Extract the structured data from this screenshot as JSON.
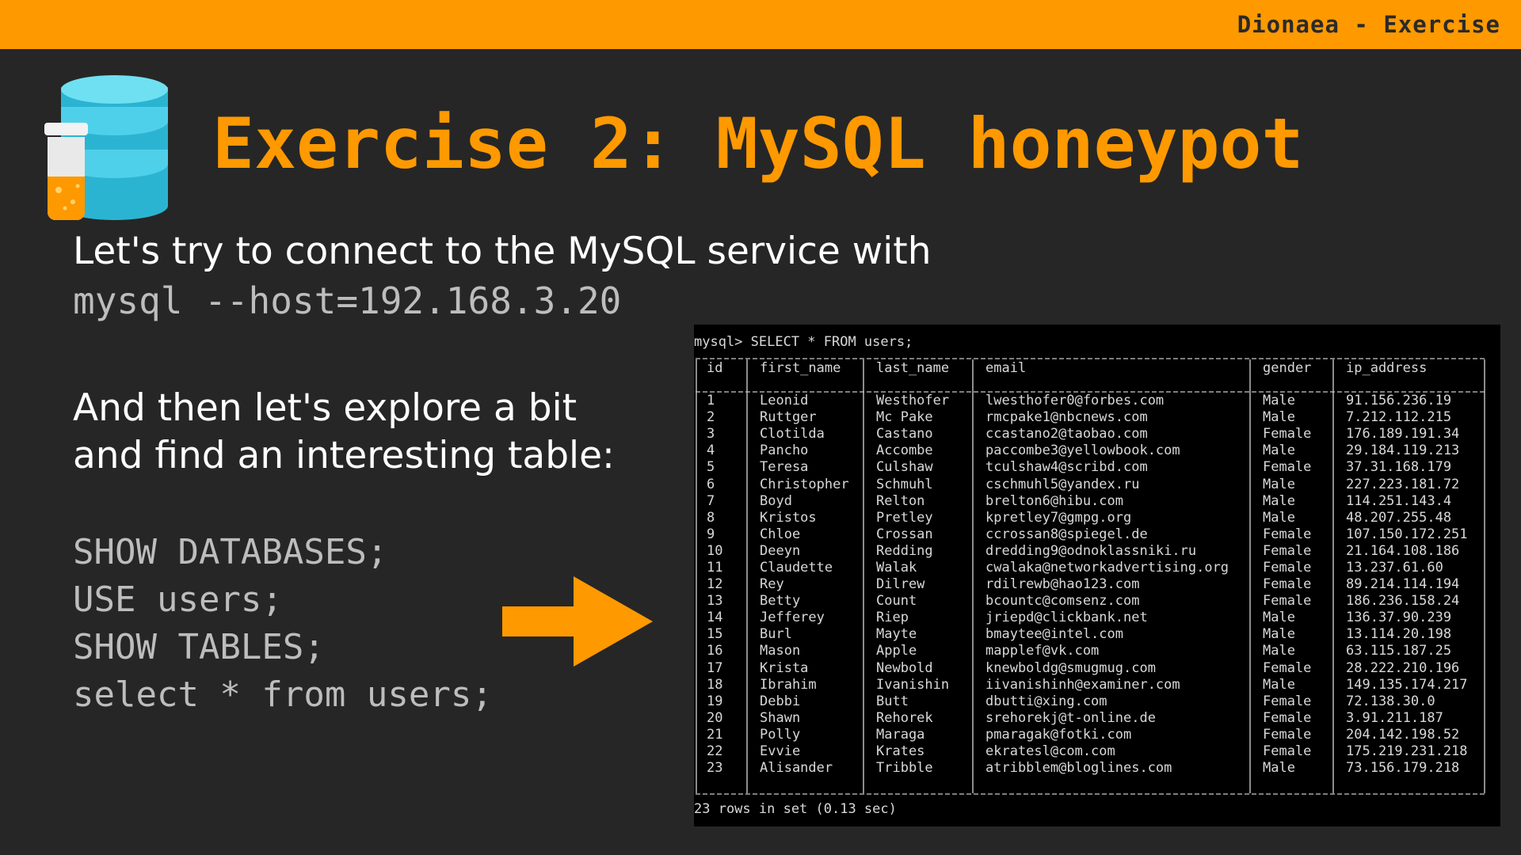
{
  "header": {
    "title": "Dionaea - Exercise"
  },
  "slide": {
    "title": "Exercise 2: MySQL honeypot",
    "intro": "Let's try to connect to the MySQL service with",
    "command": "mysql --host=192.168.3.20",
    "explore_lines": [
      "And then let's explore a bit",
      "and find an interesting table:"
    ],
    "sql_lines": [
      "SHOW DATABASES;",
      "USE users;",
      "SHOW TABLES;",
      "select * from users;"
    ]
  },
  "icons": {
    "logo": "database-jar-icon",
    "arrow": "arrow-right-icon"
  },
  "colors": {
    "accent": "#ff9900",
    "background": "#262626",
    "database": "#3ec6e0",
    "terminal_bg": "#000000"
  },
  "terminal": {
    "prompt": "mysql> SELECT * FROM users;",
    "columns": [
      "id",
      "first_name",
      "last_name",
      "email",
      "gender",
      "ip_address"
    ],
    "rows": [
      [
        "1",
        "Leonid",
        "Westhofer",
        "lwesthofer0@forbes.com",
        "Male",
        "91.156.236.19"
      ],
      [
        "2",
        "Ruttger",
        "Mc Pake",
        "rmcpake1@nbcnews.com",
        "Male",
        "7.212.112.215"
      ],
      [
        "3",
        "Clotilda",
        "Castano",
        "ccastano2@taobao.com",
        "Female",
        "176.189.191.34"
      ],
      [
        "4",
        "Pancho",
        "Accombe",
        "paccombe3@yellowbook.com",
        "Male",
        "29.184.119.213"
      ],
      [
        "5",
        "Teresa",
        "Culshaw",
        "tculshaw4@scribd.com",
        "Female",
        "37.31.168.179"
      ],
      [
        "6",
        "Christopher",
        "Schmuhl",
        "cschmuhl5@yandex.ru",
        "Male",
        "227.223.181.72"
      ],
      [
        "7",
        "Boyd",
        "Relton",
        "brelton6@hibu.com",
        "Male",
        "114.251.143.4"
      ],
      [
        "8",
        "Kristos",
        "Pretley",
        "kpretley7@gmpg.org",
        "Male",
        "48.207.255.48"
      ],
      [
        "9",
        "Chloe",
        "Crossan",
        "ccrossan8@spiegel.de",
        "Female",
        "107.150.172.251"
      ],
      [
        "10",
        "Deeyn",
        "Redding",
        "dredding9@odnoklassniki.ru",
        "Female",
        "21.164.108.186"
      ],
      [
        "11",
        "Claudette",
        "Walak",
        "cwalaka@networkadvertising.org",
        "Female",
        "13.237.61.60"
      ],
      [
        "12",
        "Rey",
        "Dilrew",
        "rdilrewb@hao123.com",
        "Female",
        "89.214.114.194"
      ],
      [
        "13",
        "Betty",
        "Count",
        "bcountc@comsenz.com",
        "Female",
        "186.236.158.24"
      ],
      [
        "14",
        "Jefferey",
        "Riep",
        "jriepd@clickbank.net",
        "Male",
        "136.37.90.239"
      ],
      [
        "15",
        "Burl",
        "Mayte",
        "bmaytee@intel.com",
        "Male",
        "13.114.20.198"
      ],
      [
        "16",
        "Mason",
        "Apple",
        "mapplef@vk.com",
        "Male",
        "63.115.187.25"
      ],
      [
        "17",
        "Krista",
        "Newbold",
        "knewboldg@smugmug.com",
        "Female",
        "28.222.210.196"
      ],
      [
        "18",
        "Ibrahim",
        "Ivanishin",
        "iivanishinh@examiner.com",
        "Male",
        "149.135.174.217"
      ],
      [
        "19",
        "Debbi",
        "Butt",
        "dbutti@xing.com",
        "Female",
        "72.138.30.0"
      ],
      [
        "20",
        "Shawn",
        "Rehorek",
        "srehorekj@t-online.de",
        "Female",
        "3.91.211.187"
      ],
      [
        "21",
        "Polly",
        "Maraga",
        "pmaragak@fotki.com",
        "Female",
        "204.142.198.52"
      ],
      [
        "22",
        "Evvie",
        "Krates",
        "ekratesl@com.com",
        "Female",
        "175.219.231.218"
      ],
      [
        "23",
        "Alisander",
        "Tribble",
        "atribblem@bloglines.com",
        "Male",
        "73.156.179.218"
      ]
    ],
    "footer": "23 rows in set (0.13 sec)"
  }
}
